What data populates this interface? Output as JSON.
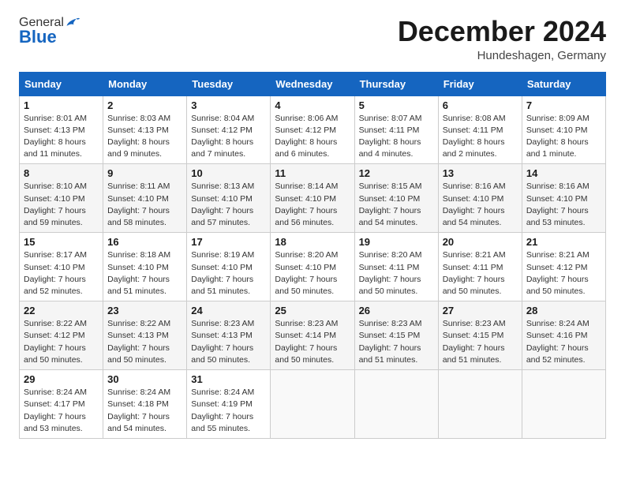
{
  "logo": {
    "general": "General",
    "blue": "Blue"
  },
  "header": {
    "month": "December 2024",
    "location": "Hundeshagen, Germany"
  },
  "weekdays": [
    "Sunday",
    "Monday",
    "Tuesday",
    "Wednesday",
    "Thursday",
    "Friday",
    "Saturday"
  ],
  "weeks": [
    [
      {
        "day": "1",
        "sunrise": "8:01 AM",
        "sunset": "4:13 PM",
        "daylight": "8 hours and 11 minutes."
      },
      {
        "day": "2",
        "sunrise": "8:03 AM",
        "sunset": "4:13 PM",
        "daylight": "8 hours and 9 minutes."
      },
      {
        "day": "3",
        "sunrise": "8:04 AM",
        "sunset": "4:12 PM",
        "daylight": "8 hours and 7 minutes."
      },
      {
        "day": "4",
        "sunrise": "8:06 AM",
        "sunset": "4:12 PM",
        "daylight": "8 hours and 6 minutes."
      },
      {
        "day": "5",
        "sunrise": "8:07 AM",
        "sunset": "4:11 PM",
        "daylight": "8 hours and 4 minutes."
      },
      {
        "day": "6",
        "sunrise": "8:08 AM",
        "sunset": "4:11 PM",
        "daylight": "8 hours and 2 minutes."
      },
      {
        "day": "7",
        "sunrise": "8:09 AM",
        "sunset": "4:10 PM",
        "daylight": "8 hours and 1 minute."
      }
    ],
    [
      {
        "day": "8",
        "sunrise": "8:10 AM",
        "sunset": "4:10 PM",
        "daylight": "7 hours and 59 minutes."
      },
      {
        "day": "9",
        "sunrise": "8:11 AM",
        "sunset": "4:10 PM",
        "daylight": "7 hours and 58 minutes."
      },
      {
        "day": "10",
        "sunrise": "8:13 AM",
        "sunset": "4:10 PM",
        "daylight": "7 hours and 57 minutes."
      },
      {
        "day": "11",
        "sunrise": "8:14 AM",
        "sunset": "4:10 PM",
        "daylight": "7 hours and 56 minutes."
      },
      {
        "day": "12",
        "sunrise": "8:15 AM",
        "sunset": "4:10 PM",
        "daylight": "7 hours and 54 minutes."
      },
      {
        "day": "13",
        "sunrise": "8:16 AM",
        "sunset": "4:10 PM",
        "daylight": "7 hours and 54 minutes."
      },
      {
        "day": "14",
        "sunrise": "8:16 AM",
        "sunset": "4:10 PM",
        "daylight": "7 hours and 53 minutes."
      }
    ],
    [
      {
        "day": "15",
        "sunrise": "8:17 AM",
        "sunset": "4:10 PM",
        "daylight": "7 hours and 52 minutes."
      },
      {
        "day": "16",
        "sunrise": "8:18 AM",
        "sunset": "4:10 PM",
        "daylight": "7 hours and 51 minutes."
      },
      {
        "day": "17",
        "sunrise": "8:19 AM",
        "sunset": "4:10 PM",
        "daylight": "7 hours and 51 minutes."
      },
      {
        "day": "18",
        "sunrise": "8:20 AM",
        "sunset": "4:10 PM",
        "daylight": "7 hours and 50 minutes."
      },
      {
        "day": "19",
        "sunrise": "8:20 AM",
        "sunset": "4:11 PM",
        "daylight": "7 hours and 50 minutes."
      },
      {
        "day": "20",
        "sunrise": "8:21 AM",
        "sunset": "4:11 PM",
        "daylight": "7 hours and 50 minutes."
      },
      {
        "day": "21",
        "sunrise": "8:21 AM",
        "sunset": "4:12 PM",
        "daylight": "7 hours and 50 minutes."
      }
    ],
    [
      {
        "day": "22",
        "sunrise": "8:22 AM",
        "sunset": "4:12 PM",
        "daylight": "7 hours and 50 minutes."
      },
      {
        "day": "23",
        "sunrise": "8:22 AM",
        "sunset": "4:13 PM",
        "daylight": "7 hours and 50 minutes."
      },
      {
        "day": "24",
        "sunrise": "8:23 AM",
        "sunset": "4:13 PM",
        "daylight": "7 hours and 50 minutes."
      },
      {
        "day": "25",
        "sunrise": "8:23 AM",
        "sunset": "4:14 PM",
        "daylight": "7 hours and 50 minutes."
      },
      {
        "day": "26",
        "sunrise": "8:23 AM",
        "sunset": "4:15 PM",
        "daylight": "7 hours and 51 minutes."
      },
      {
        "day": "27",
        "sunrise": "8:23 AM",
        "sunset": "4:15 PM",
        "daylight": "7 hours and 51 minutes."
      },
      {
        "day": "28",
        "sunrise": "8:24 AM",
        "sunset": "4:16 PM",
        "daylight": "7 hours and 52 minutes."
      }
    ],
    [
      {
        "day": "29",
        "sunrise": "8:24 AM",
        "sunset": "4:17 PM",
        "daylight": "7 hours and 53 minutes."
      },
      {
        "day": "30",
        "sunrise": "8:24 AM",
        "sunset": "4:18 PM",
        "daylight": "7 hours and 54 minutes."
      },
      {
        "day": "31",
        "sunrise": "8:24 AM",
        "sunset": "4:19 PM",
        "daylight": "7 hours and 55 minutes."
      },
      null,
      null,
      null,
      null
    ]
  ],
  "labels": {
    "sunrise": "Sunrise:",
    "sunset": "Sunset:",
    "daylight": "Daylight:"
  }
}
